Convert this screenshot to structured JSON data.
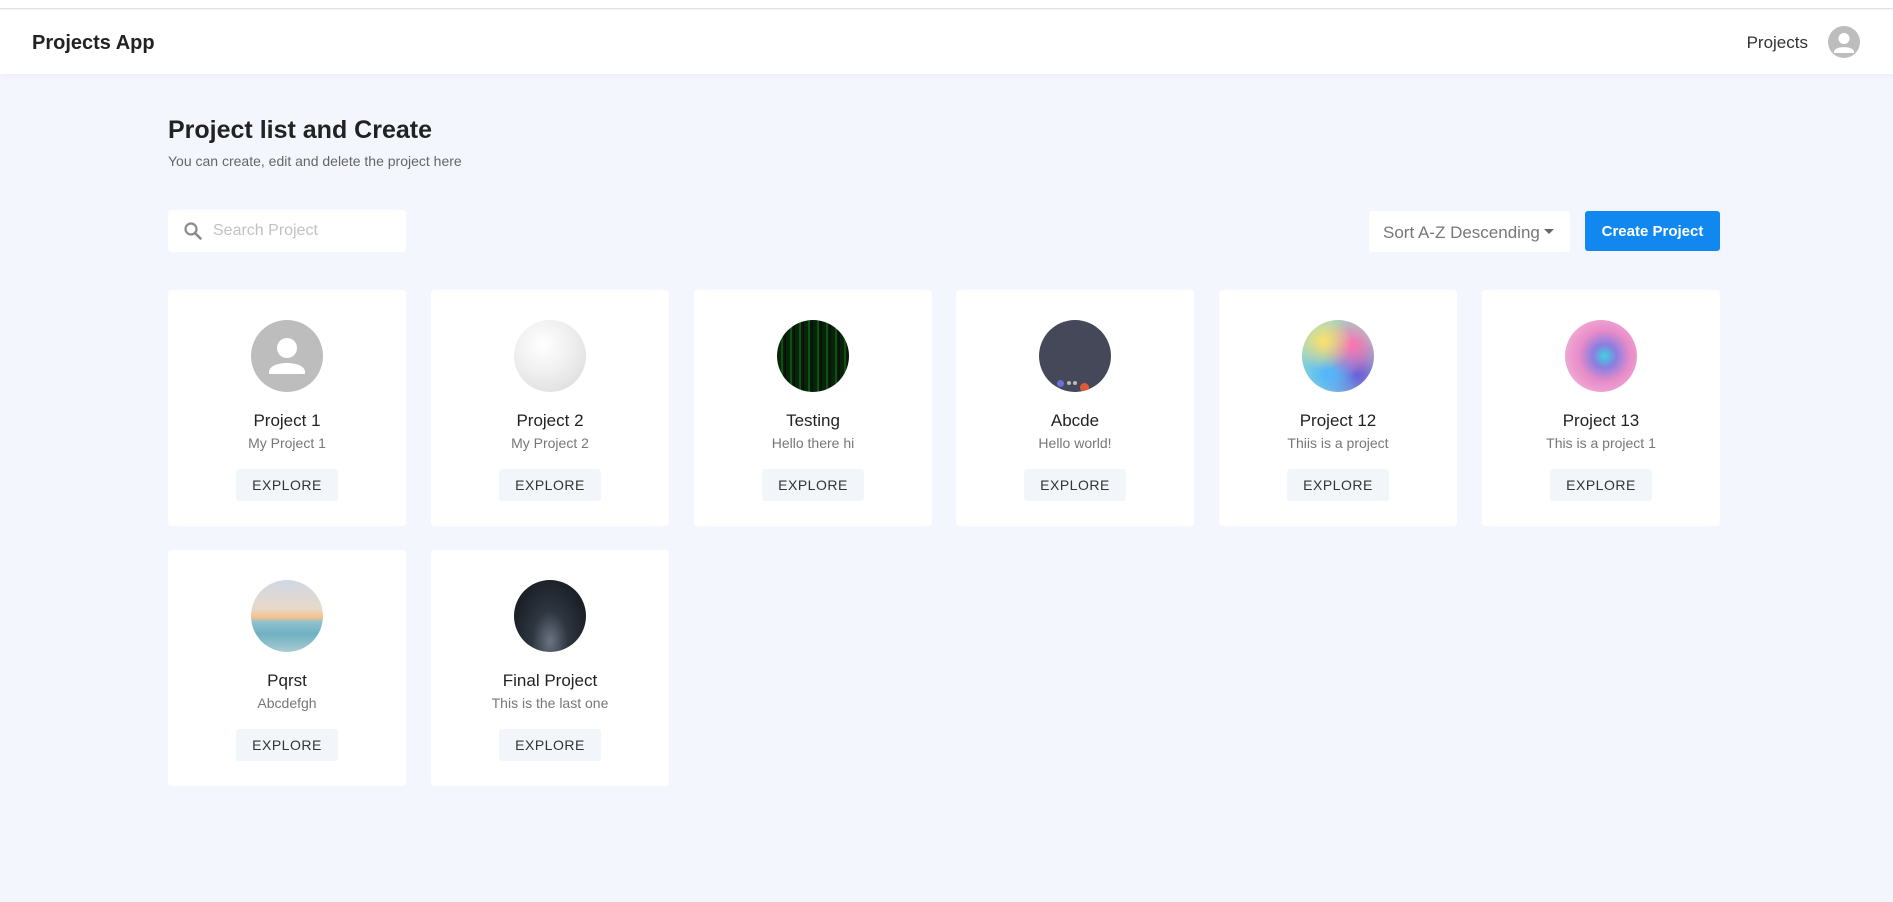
{
  "header": {
    "brand": "Projects App",
    "nav_projects": "Projects",
    "avatar_icon": "user-avatar-icon"
  },
  "page": {
    "title": "Project list and Create",
    "subtitle": "You can create, edit and delete the project here"
  },
  "toolbar": {
    "search_placeholder": "Search Project",
    "search_value": "",
    "sort_label": "Sort A-Z Descending",
    "create_label": "Create Project"
  },
  "colors": {
    "accent": "#1188f0",
    "background": "#f3f6fc",
    "card": "#ffffff"
  },
  "projects": [
    {
      "title": "Project 1",
      "description": "My Project 1",
      "button": "EXPLORE",
      "image": "default-avatar"
    },
    {
      "title": "Project 2",
      "description": "My Project 2",
      "button": "EXPLORE",
      "image": "crumpled-paper"
    },
    {
      "title": "Testing",
      "description": "Hello there hi",
      "button": "EXPLORE",
      "image": "green-matrix"
    },
    {
      "title": "Abcde",
      "description": "Hello world!",
      "button": "EXPLORE",
      "image": "dark-dots"
    },
    {
      "title": "Project 12",
      "description": "Thiis is a project",
      "button": "EXPLORE",
      "image": "rainbow-clouds"
    },
    {
      "title": "Project 13",
      "description": "This is a project 1",
      "button": "EXPLORE",
      "image": "pink-sphere"
    },
    {
      "title": "Pqrst",
      "description": "Abcdefgh",
      "button": "EXPLORE",
      "image": "beach-sunset"
    },
    {
      "title": "Final Project",
      "description": "This is the last one",
      "button": "EXPLORE",
      "image": "night-landscape"
    }
  ]
}
